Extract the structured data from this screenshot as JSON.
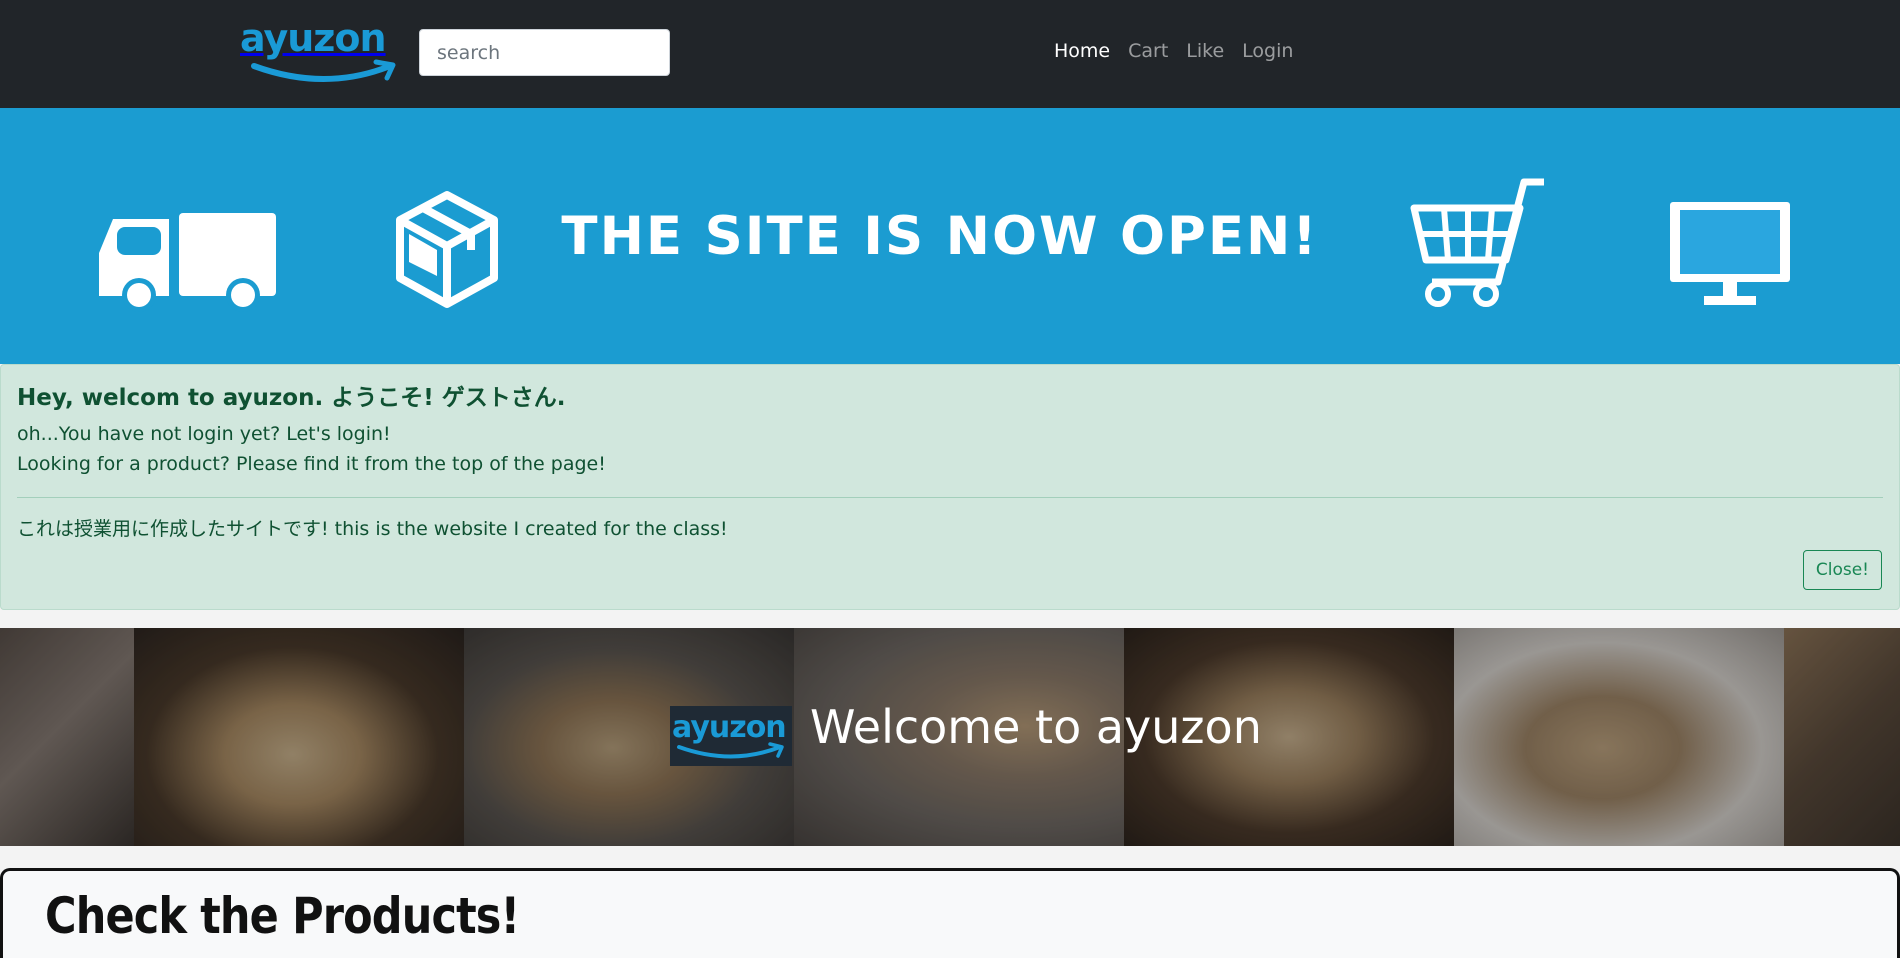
{
  "navbar": {
    "logo_text": "ayuzon",
    "search_placeholder": "search",
    "links": [
      {
        "label": "Home",
        "active": true
      },
      {
        "label": "Cart",
        "active": false
      },
      {
        "label": "Like",
        "active": false
      },
      {
        "label": "Login",
        "active": false
      }
    ]
  },
  "banner": {
    "title": "THE SITE IS NOW OPEN!",
    "icons": [
      "delivery-truck-icon",
      "package-box-icon",
      "shopping-cart-icon",
      "monitor-icon"
    ]
  },
  "alert": {
    "heading": "Hey, welcom to ayuzon. ようこそ! ゲストさん.",
    "line1": "oh...You have not login yet? Let's login!",
    "line2": "Looking for a product? Please find it from the top of the page!",
    "note": "これは授業用に作成したサイトです! this is the website I created for the class!",
    "close_label": "Close!"
  },
  "hero": {
    "logo_text": "ayuzon",
    "title": "Welcome to ayuzon"
  },
  "products": {
    "heading": "Check the Products!"
  },
  "colors": {
    "navbar_bg": "#212529",
    "brand_blue": "#1a9ad6",
    "banner_bg": "#1b9cd1",
    "alert_bg": "#d1e7dd",
    "alert_text": "#0f5132"
  }
}
